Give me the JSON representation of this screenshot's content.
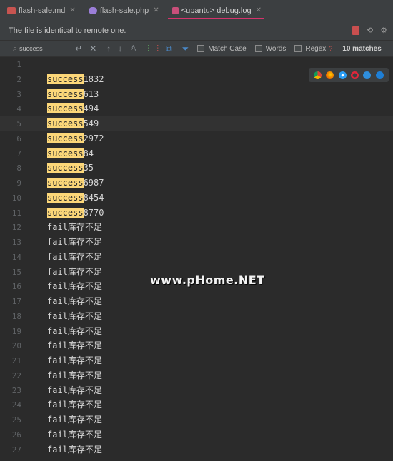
{
  "tabs": [
    {
      "label": "flash-sale.md",
      "icon": "markdown-file-icon",
      "color": "#c75450"
    },
    {
      "label": "flash-sale.php",
      "icon": "php-file-icon",
      "color": "#9b7ed8"
    },
    {
      "label": "<ubantu> debug.log",
      "icon": "log-file-icon",
      "color": "#c94f7a",
      "active": true
    }
  ],
  "notice": {
    "text": "The file is identical to remote one."
  },
  "search": {
    "query": "success",
    "match_case_label": "Match Case",
    "words_label": "Words",
    "regex_label": "Regex",
    "regex_help": "?",
    "matches": "10 matches"
  },
  "watermark": "www.pHome.NET",
  "browsers": [
    "chrome-icon",
    "firefox-icon",
    "safari-icon",
    "opera-icon",
    "ie-icon",
    "edge-icon"
  ],
  "highlight_color": "#fcd779",
  "editor": {
    "cursor_line": 5,
    "lines": [
      {
        "n": "1",
        "match": "",
        "rest": ""
      },
      {
        "n": "2",
        "match": "success",
        "rest": "1832"
      },
      {
        "n": "3",
        "match": "success",
        "rest": "613"
      },
      {
        "n": "4",
        "match": "success",
        "rest": "494"
      },
      {
        "n": "5",
        "match": "success",
        "rest": "549"
      },
      {
        "n": "6",
        "match": "success",
        "rest": "2972"
      },
      {
        "n": "7",
        "match": "success",
        "rest": "84"
      },
      {
        "n": "8",
        "match": "success",
        "rest": "35"
      },
      {
        "n": "9",
        "match": "success",
        "rest": "6987"
      },
      {
        "n": "10",
        "match": "success",
        "rest": "8454"
      },
      {
        "n": "11",
        "match": "success",
        "rest": "8770"
      },
      {
        "n": "12",
        "match": "",
        "rest": "fail库存不足"
      },
      {
        "n": "13",
        "match": "",
        "rest": "fail库存不足"
      },
      {
        "n": "14",
        "match": "",
        "rest": "fail库存不足"
      },
      {
        "n": "15",
        "match": "",
        "rest": "fail库存不足"
      },
      {
        "n": "16",
        "match": "",
        "rest": "fail库存不足"
      },
      {
        "n": "17",
        "match": "",
        "rest": "fail库存不足"
      },
      {
        "n": "18",
        "match": "",
        "rest": "fail库存不足"
      },
      {
        "n": "19",
        "match": "",
        "rest": "fail库存不足"
      },
      {
        "n": "20",
        "match": "",
        "rest": "fail库存不足"
      },
      {
        "n": "21",
        "match": "",
        "rest": "fail库存不足"
      },
      {
        "n": "22",
        "match": "",
        "rest": "fail库存不足"
      },
      {
        "n": "23",
        "match": "",
        "rest": "fail库存不足"
      },
      {
        "n": "24",
        "match": "",
        "rest": "fail库存不足"
      },
      {
        "n": "25",
        "match": "",
        "rest": "fail库存不足"
      },
      {
        "n": "26",
        "match": "",
        "rest": "fail库存不足"
      },
      {
        "n": "27",
        "match": "",
        "rest": "fail库存不足"
      }
    ]
  }
}
